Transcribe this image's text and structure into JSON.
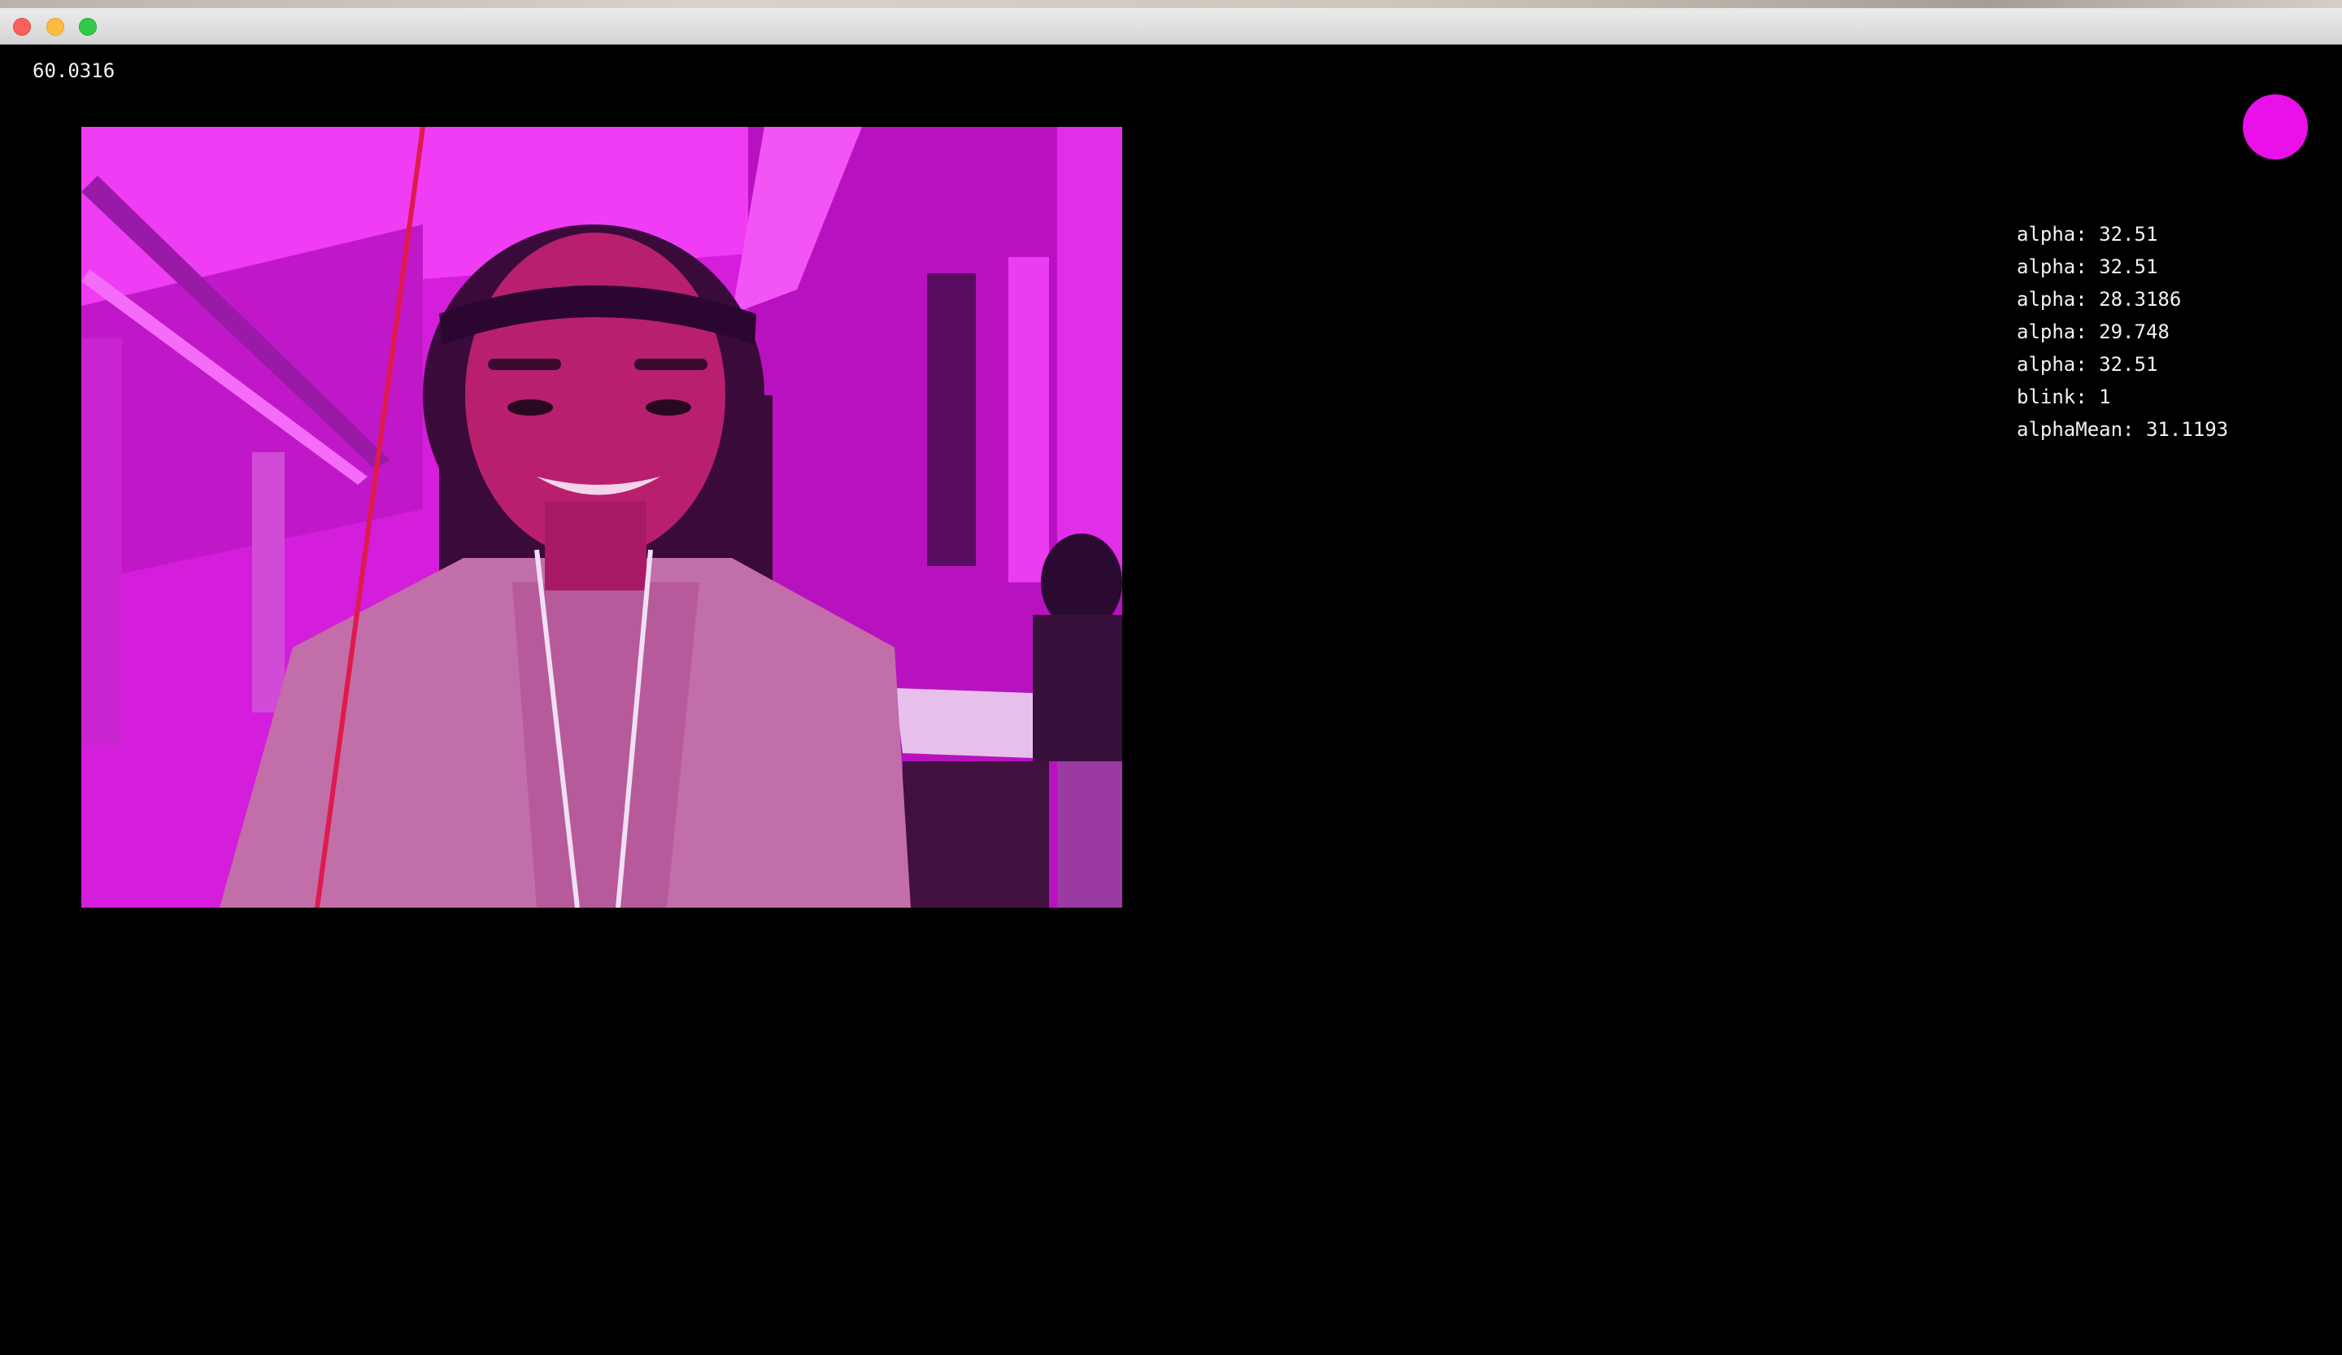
{
  "fps_readout": "60.0316",
  "indicator": {
    "color": "#ea10ea"
  },
  "camera_feed": {
    "tint": "#e21ae6"
  },
  "readout": {
    "lines": [
      "alpha: 32.51",
      "alpha: 32.51",
      "alpha: 28.3186",
      "alpha: 29.748",
      "alpha: 32.51",
      "blink: 1",
      "alphaMean: 31.1193"
    ]
  }
}
